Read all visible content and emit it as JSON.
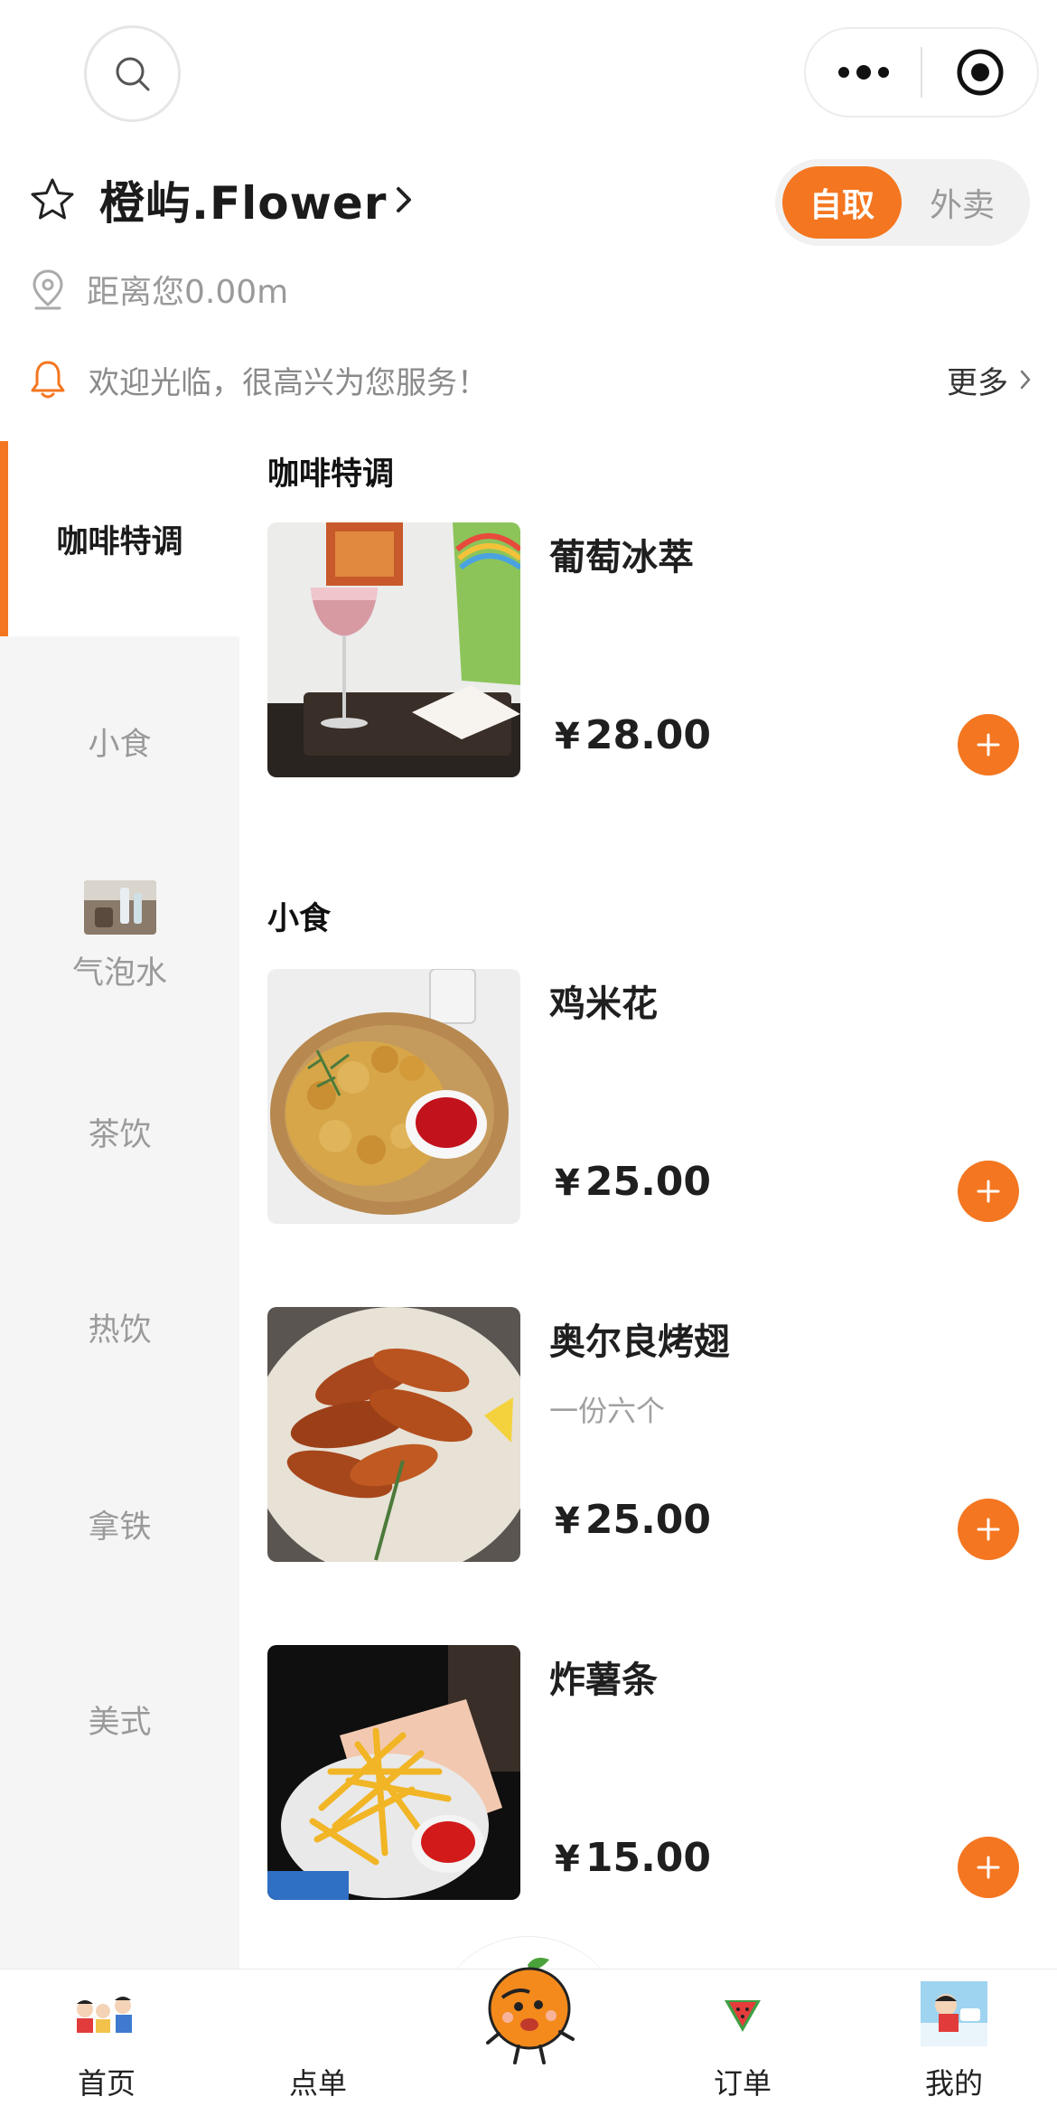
{
  "store": {
    "name": "橙屿.Flower",
    "distance": "距离您0.00m",
    "notice": "欢迎光临，很高兴为您服务！",
    "more": "更多",
    "modes": [
      "自取",
      "外卖"
    ],
    "active_mode": "自取"
  },
  "sidebar": {
    "items": [
      {
        "label": "咖啡特调",
        "active": true
      },
      {
        "label": "小食"
      },
      {
        "label": "气泡水"
      },
      {
        "label": "茶饮"
      },
      {
        "label": "热饮"
      },
      {
        "label": "拿铁"
      },
      {
        "label": "美式"
      }
    ]
  },
  "sections": [
    {
      "title": "咖啡特调",
      "products": [
        {
          "name": "葡萄冰萃",
          "currency": "¥",
          "price": "28.00",
          "image": "cocktail-glass-photo"
        }
      ]
    },
    {
      "title": "小食",
      "products": [
        {
          "name": "鸡米花",
          "currency": "¥",
          "price": "25.00",
          "image": "popcorn-chicken-photo"
        },
        {
          "name": "奥尔良烤翅",
          "desc": "一份六个",
          "currency": "¥",
          "price": "25.00",
          "image": "roast-wings-photo"
        },
        {
          "name": "炸薯条",
          "currency": "¥",
          "price": "15.00",
          "image": "french-fries-photo"
        }
      ]
    }
  ],
  "tabbar": {
    "items": [
      {
        "label": "首页",
        "icon": "family-cartoon-icon"
      },
      {
        "label": "点单",
        "icon": "order-icon"
      },
      {
        "label": "订单",
        "icon": "watermelon-icon"
      },
      {
        "label": "我的",
        "icon": "cartoon-avatar-icon"
      }
    ],
    "center_icon": "orange-mascot-icon"
  },
  "colors": {
    "accent": "#f47620",
    "sidebar_bg": "#f5f5f5",
    "muted_text": "#9a9a9a"
  }
}
